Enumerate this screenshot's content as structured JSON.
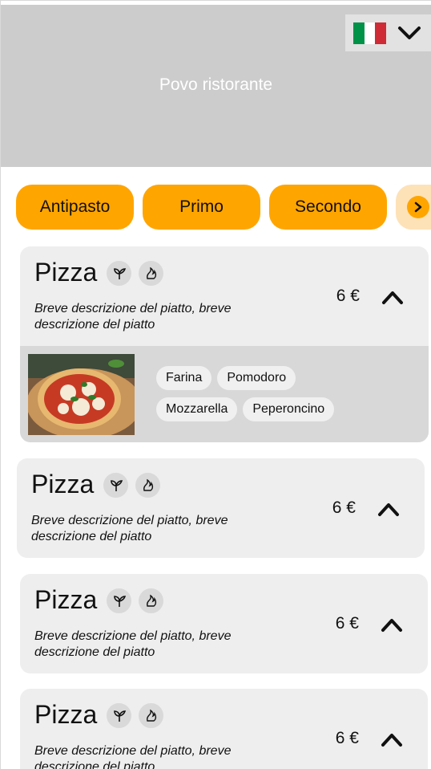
{
  "header": {
    "restaurant_name": "Povo ristorante",
    "language": {
      "flag": "italian-flag",
      "colors": [
        "#009246",
        "#ffffff",
        "#ce2b37"
      ]
    }
  },
  "categories": {
    "tabs": [
      {
        "label": "Antipasto"
      },
      {
        "label": "Primo"
      },
      {
        "label": "Secondo"
      }
    ],
    "more_icon": "chevron-right-icon"
  },
  "accent_color": "#ffa500",
  "dishes": [
    {
      "name": "Pizza",
      "description": "Breve descrizione del piatto, breve descrizione del piatto",
      "price": "6 €",
      "badges": [
        "vegetarian-icon",
        "spicy-icon"
      ],
      "expanded": true,
      "ingredients": [
        "Farina",
        "Pomodoro",
        "Mozzarella",
        "Peperoncino"
      ]
    },
    {
      "name": "Pizza",
      "description": "Breve descrizione del piatto, breve descrizione del piatto",
      "price": "6 €",
      "badges": [
        "vegetarian-icon",
        "spicy-icon"
      ],
      "expanded": false
    },
    {
      "name": "Pizza",
      "description": "Breve descrizione del piatto, breve descrizione del piatto",
      "price": "6 €",
      "badges": [
        "vegetarian-icon",
        "spicy-icon"
      ],
      "expanded": false
    },
    {
      "name": "Pizza",
      "description": "Breve descrizione del piatto, breve descrizione del piatto",
      "price": "6 €",
      "badges": [
        "vegetarian-icon",
        "spicy-icon"
      ],
      "expanded": false
    }
  ]
}
